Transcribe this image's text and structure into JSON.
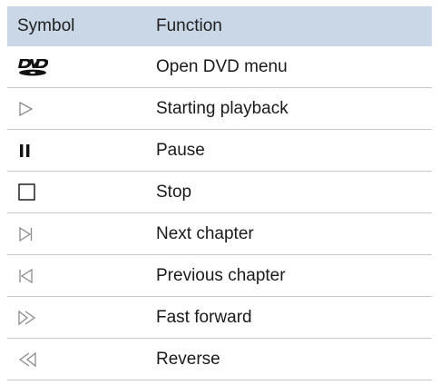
{
  "table": {
    "headers": {
      "symbol": "Symbol",
      "function": "Function"
    },
    "rows": [
      {
        "icon": "dvd-logo-icon",
        "function": "Open DVD menu"
      },
      {
        "icon": "play-icon",
        "function": "Starting playback"
      },
      {
        "icon": "pause-icon",
        "function": "Pause"
      },
      {
        "icon": "stop-icon",
        "function": "Stop"
      },
      {
        "icon": "next-chapter-icon",
        "function": "Next chapter"
      },
      {
        "icon": "previous-chapter-icon",
        "function": "Previous chapter"
      },
      {
        "icon": "fast-forward-icon",
        "function": "Fast forward"
      },
      {
        "icon": "reverse-icon",
        "function": "Reverse"
      }
    ]
  },
  "colors": {
    "header_background": "#c9d7e6",
    "row_divider": "#c7c7c7",
    "icon_gray": "#8a8a8a",
    "icon_dark": "#111111"
  }
}
